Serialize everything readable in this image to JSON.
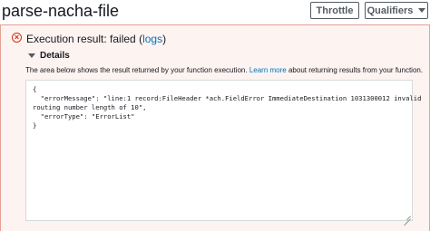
{
  "header": {
    "title": "parse-nacha-file",
    "throttle_label": "Throttle",
    "qualifiers_label": "Qualifiers"
  },
  "result": {
    "status_prefix": "Execution result: failed (",
    "logs_link": "logs",
    "status_suffix": ")",
    "status_icon": "error-circle-icon",
    "status_color": "#d13212",
    "details_label": "Details",
    "description_prefix": "The area below shows the result returned by your function execution.",
    "learn_more_link": "Learn more",
    "description_suffix": "about returning results from your function.",
    "output_lines": [
      "{",
      "  \"errorMessage\": \"line:1 record:FileHeader *ach.FieldError ImmediateDestination 1031300012 invalid",
      "routing number length of 10\",",
      "  \"errorType\": \"ErrorList\"",
      "}"
    ]
  }
}
